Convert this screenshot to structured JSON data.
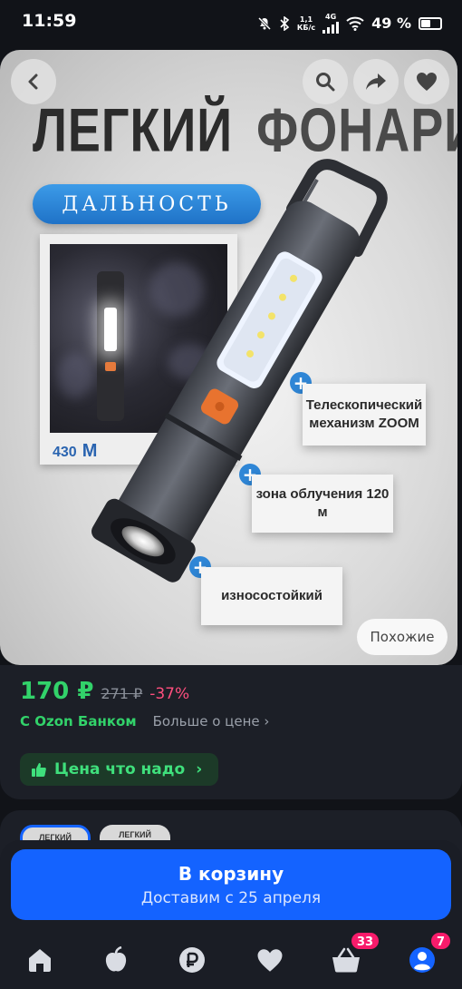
{
  "status_bar": {
    "time": "11:59",
    "network_speed_value": "1,1",
    "network_speed_unit": "КБ/с",
    "network_type": "4G",
    "battery": "49 %"
  },
  "product_image": {
    "headline_word1": "ЛЕГКИЙ",
    "headline_word2": "ФОНАРИК",
    "range_label": "ДАЛЬНОСТЬ",
    "range_value": "430",
    "range_unit": "М",
    "features": [
      {
        "line1": "Телескопический",
        "line2": "механизм ZOOM"
      },
      {
        "line1": "зона облучения 120 м",
        "line2": ""
      },
      {
        "line1": "износостойкий",
        "line2": ""
      }
    ],
    "similar_button": "Похожие"
  },
  "price": {
    "current": "170 ₽",
    "old": "271 ₽",
    "discount": "-37%",
    "bank_label": "С Ozon Банком",
    "more_link": "Больше о цене",
    "badge": "Цена что надо"
  },
  "variants": {
    "thumb_text": "ЛЕГКИЙ ФОНАРИК"
  },
  "cart": {
    "title": "В корзину",
    "subtitle": "Доставим с 25 апреля"
  },
  "nav": {
    "cart_count": "33",
    "profile_count": "7"
  },
  "colors": {
    "accent": "#1463ff",
    "price_green": "#32d26a",
    "discount_pink": "#ff4f7e",
    "badge_pink": "#f81b6b"
  }
}
